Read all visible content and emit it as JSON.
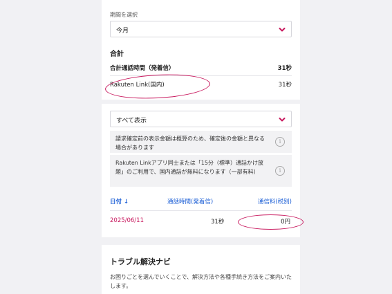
{
  "period": {
    "label": "期間を選択",
    "selected": "今月"
  },
  "summary": {
    "title": "合計",
    "total_label": "合計通話時間（発着信）",
    "total_value": "31秒",
    "link_label": "Rakuten Link(国内)",
    "link_value": "31秒"
  },
  "filter": {
    "selected": "すべて表示"
  },
  "notices": [
    "請求確定前の表示金額は概算のため、確定後の金額と異なる場合があります",
    "Rakuten Linkアプリ同士または「15分（標準）通話かけ放題」のご利用で、国内通話が無料になります（一部有料）"
  ],
  "table": {
    "headers": {
      "date": "日付 ↓",
      "duration": "通話時間(発着信)",
      "fee": "通信料(税別)"
    },
    "rows": [
      {
        "date": "2025/06/11",
        "duration": "31秒",
        "fee": "0円"
      }
    ]
  },
  "trouble": {
    "title": "トラブル解決ナビ",
    "description": "お困りごとを選んでいくことで、解決方法や各種手続き方法をご案内いたします。"
  },
  "colors": {
    "accent": "#c8175d",
    "link_blue": "#1c5fd6"
  },
  "icons": {
    "dropdown": "chevron-down-icon",
    "info": "info-circle-icon"
  }
}
